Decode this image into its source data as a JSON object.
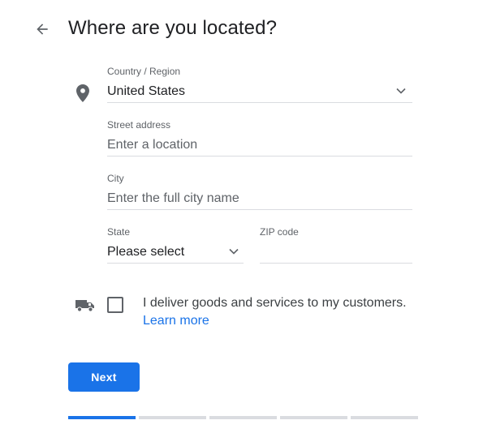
{
  "header": {
    "back_icon": "arrow-back-icon",
    "title": "Where are you located?"
  },
  "form": {
    "location_icon": "location-pin-icon",
    "country": {
      "label": "Country / Region",
      "value": "United States"
    },
    "street": {
      "label": "Street address",
      "placeholder": "Enter a location",
      "value": ""
    },
    "city": {
      "label": "City",
      "placeholder": "Enter the full city name",
      "value": ""
    },
    "state": {
      "label": "State",
      "value": "Please select"
    },
    "zip": {
      "label": "ZIP code",
      "value": ""
    }
  },
  "delivery": {
    "icon": "truck-icon",
    "checked": false,
    "text": "I deliver goods and services to my customers.",
    "link": "Learn more"
  },
  "actions": {
    "next_label": "Next"
  },
  "progress": {
    "total_steps": 5,
    "current_step": 1
  },
  "colors": {
    "accent": "#1a73e8",
    "divider": "#dadce0",
    "text": "#202124",
    "muted": "#5f6368"
  }
}
